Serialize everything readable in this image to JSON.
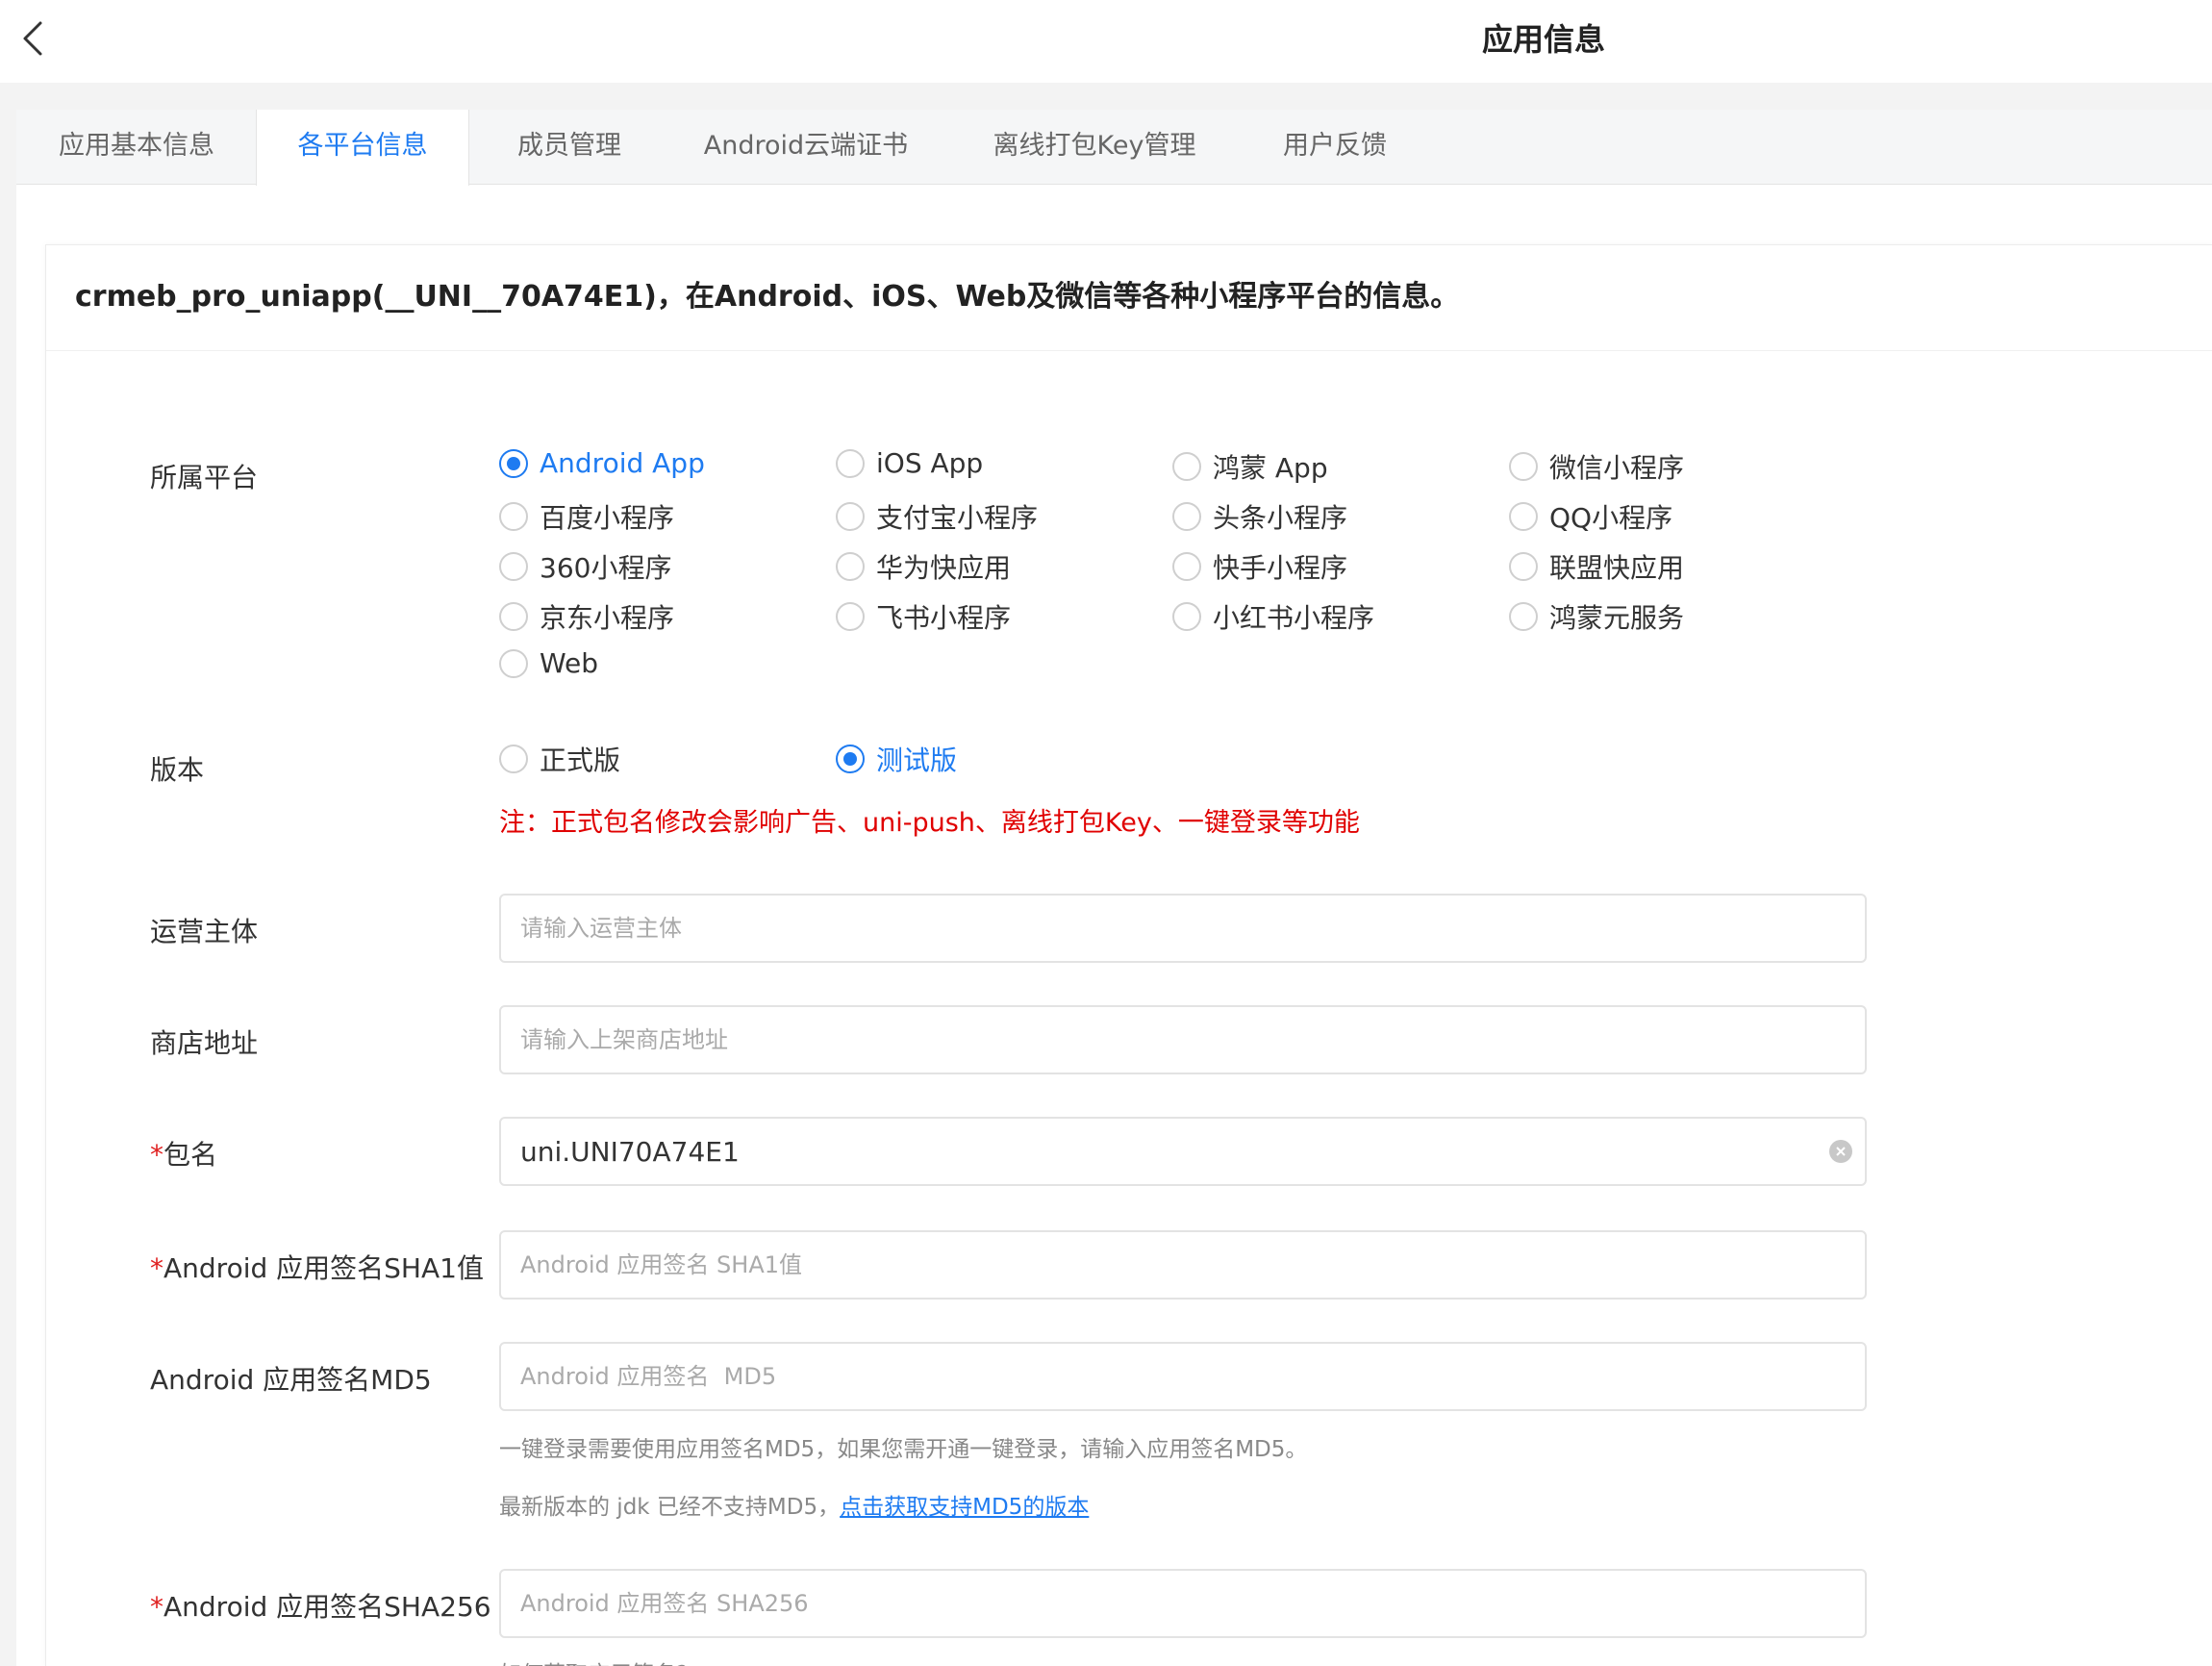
{
  "header": {
    "title": "应用信息",
    "back_icon": "chevron-left-icon"
  },
  "tabs": [
    {
      "label": "应用基本信息",
      "active": false
    },
    {
      "label": "各平台信息",
      "active": true
    },
    {
      "label": "成员管理",
      "active": false
    },
    {
      "label": "Android云端证书",
      "active": false
    },
    {
      "label": "离线打包Key管理",
      "active": false
    },
    {
      "label": "用户反馈",
      "active": false
    }
  ],
  "intro": "crmeb_pro_uniapp(__UNI__70A74E1)，在Android、iOS、Web及微信等各种小程序平台的信息。",
  "form": {
    "platform": {
      "label": "所属平台",
      "selected": "Android App",
      "options": [
        "Android App",
        "iOS App",
        "鸿蒙 App",
        "微信小程序",
        "百度小程序",
        "支付宝小程序",
        "头条小程序",
        "QQ小程序",
        "360小程序",
        "华为快应用",
        "快手小程序",
        "联盟快应用",
        "京东小程序",
        "飞书小程序",
        "小红书小程序",
        "鸿蒙元服务",
        "Web"
      ]
    },
    "version": {
      "label": "版本",
      "options": [
        "正式版",
        "测试版"
      ],
      "selected": "测试版",
      "note": "注：正式包名修改会影响广告、uni-push、离线打包Key、一键登录等功能"
    },
    "operator": {
      "label": "运营主体",
      "value": "",
      "placeholder": "请输入运营主体"
    },
    "store_url": {
      "label": "商店地址",
      "value": "",
      "placeholder": "请输入上架商店地址"
    },
    "package_name": {
      "required_mark": "*",
      "label": "包名",
      "value": "uni.UNI70A74E1",
      "placeholder": ""
    },
    "sha1": {
      "required_mark": "*",
      "label": "Android 应用签名SHA1值",
      "value": "",
      "placeholder": "Android 应用签名 SHA1值"
    },
    "md5": {
      "label": "Android 应用签名MD5",
      "value": "",
      "placeholder": "Android 应用签名  MD5",
      "help1": "一键登录需要使用应用签名MD5，如果您需开通一键登录，请输入应用签名MD5。",
      "help2_prefix": "最新版本的 jdk 已经不支持MD5，",
      "help2_link": "点击获取支持MD5的版本"
    },
    "sha256": {
      "required_mark": "*",
      "label": "Android 应用签名SHA256",
      "value": "",
      "placeholder": "Android 应用签名 SHA256",
      "help": "如何获取应用签名?"
    }
  },
  "colors": {
    "accent": "#1e7bf1",
    "warning": "#e00000",
    "required": "#e02020"
  }
}
